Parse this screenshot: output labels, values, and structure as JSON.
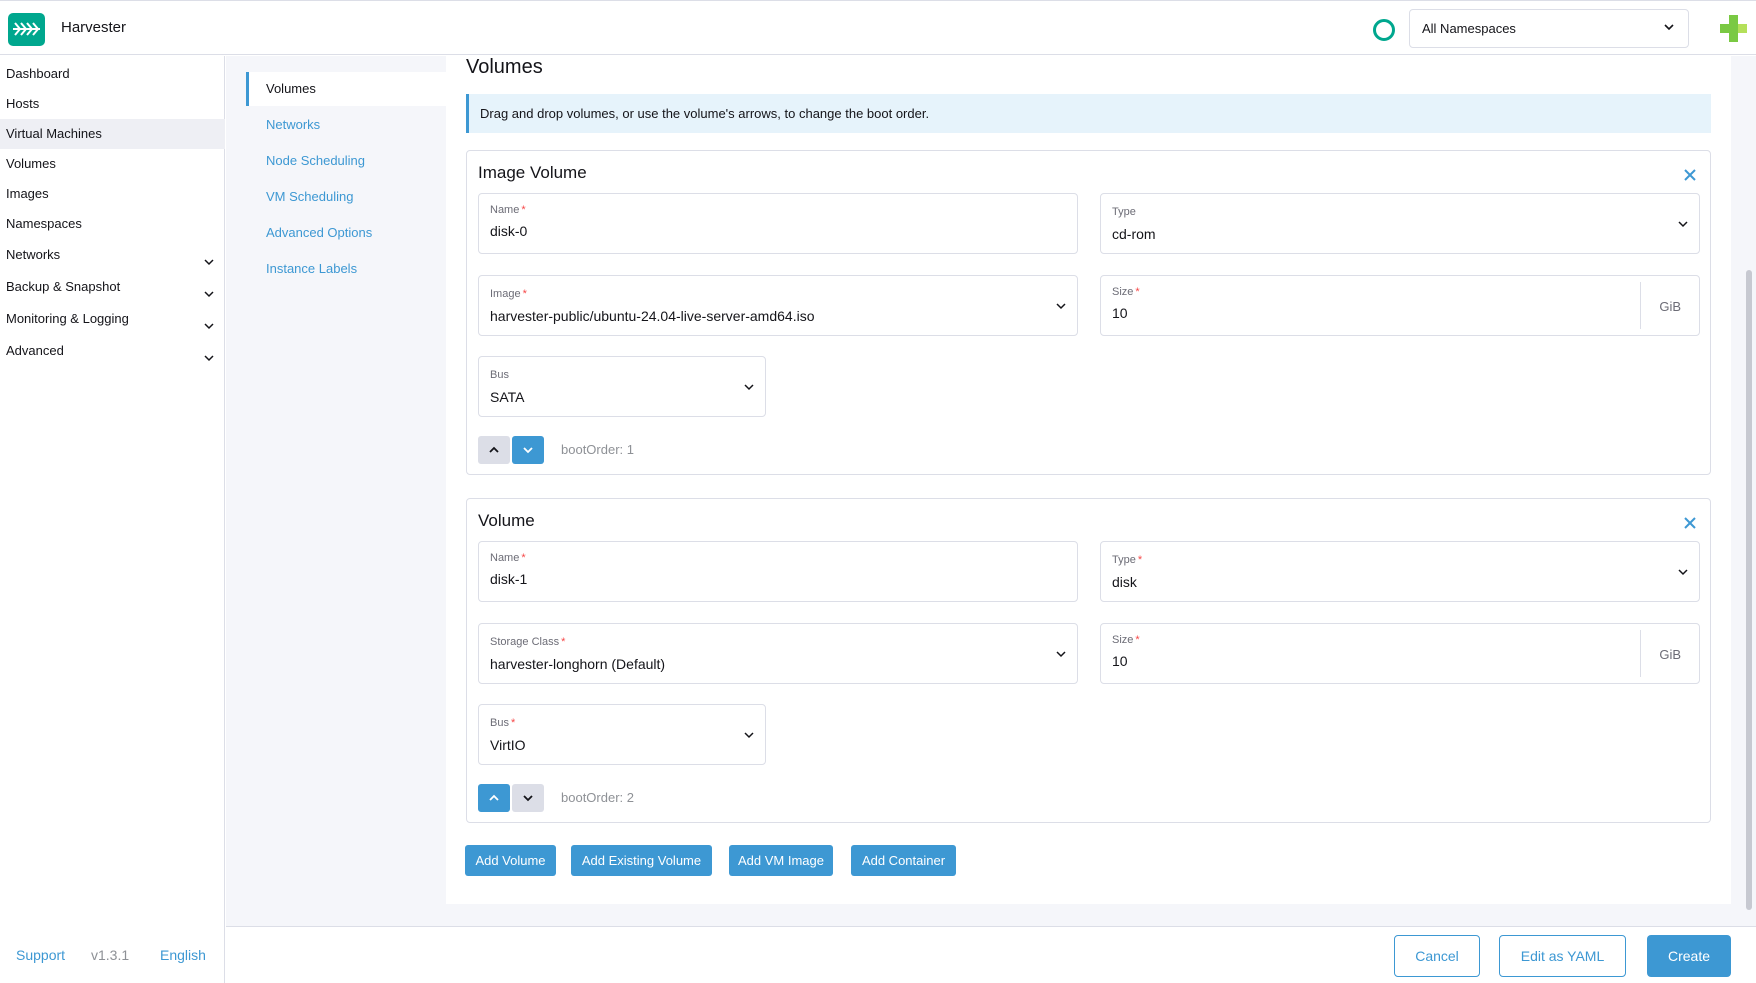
{
  "header": {
    "app_title": "Harvester",
    "namespace_select": "All Namespaces",
    "brand_color": "#00a78e",
    "accent_color": "#3d98d3"
  },
  "leftnav": {
    "items": [
      {
        "label": "Dashboard"
      },
      {
        "label": "Hosts"
      },
      {
        "label": "Virtual Machines"
      },
      {
        "label": "Volumes"
      },
      {
        "label": "Images"
      },
      {
        "label": "Namespaces"
      },
      {
        "label": "Networks"
      },
      {
        "label": "Backup & Snapshot"
      },
      {
        "label": "Monitoring & Logging"
      },
      {
        "label": "Advanced"
      }
    ],
    "footer": {
      "support": "Support",
      "version": "v1.3.1",
      "language": "English"
    }
  },
  "subnav": {
    "items": [
      {
        "label": "Volumes"
      },
      {
        "label": "Networks"
      },
      {
        "label": "Node Scheduling"
      },
      {
        "label": "VM Scheduling"
      },
      {
        "label": "Advanced Options"
      },
      {
        "label": "Instance Labels"
      }
    ]
  },
  "main": {
    "title": "Volumes",
    "banner": "Drag and drop volumes, or use the volume's arrows, to change the boot order.",
    "volumes": [
      {
        "title": "Image Volume",
        "name_label": "Name",
        "name_value": "disk-0",
        "type_label": "Type",
        "type_value": "cd-rom",
        "source_label": "Image",
        "source_value": "harvester-public/ubuntu-24.04-live-server-amd64.iso",
        "size_label": "Size",
        "size_value": "10",
        "size_unit": "GiB",
        "bus_label": "Bus",
        "bus_value": "SATA",
        "boot_order": "bootOrder: 1"
      },
      {
        "title": "Volume",
        "name_label": "Name",
        "name_value": "disk-1",
        "type_label": "Type",
        "type_value": "disk",
        "source_label": "Storage Class",
        "source_value": "harvester-longhorn (Default)",
        "size_label": "Size",
        "size_value": "10",
        "size_unit": "GiB",
        "bus_label": "Bus",
        "bus_value": "VirtIO",
        "boot_order": "bootOrder: 2"
      }
    ],
    "add_buttons": {
      "add_volume": "Add Volume",
      "add_existing_volume": "Add Existing Volume",
      "add_vm_image": "Add VM Image",
      "add_container": "Add Container"
    }
  },
  "footer_actions": {
    "cancel": "Cancel",
    "edit_yaml": "Edit as YAML",
    "create": "Create"
  }
}
